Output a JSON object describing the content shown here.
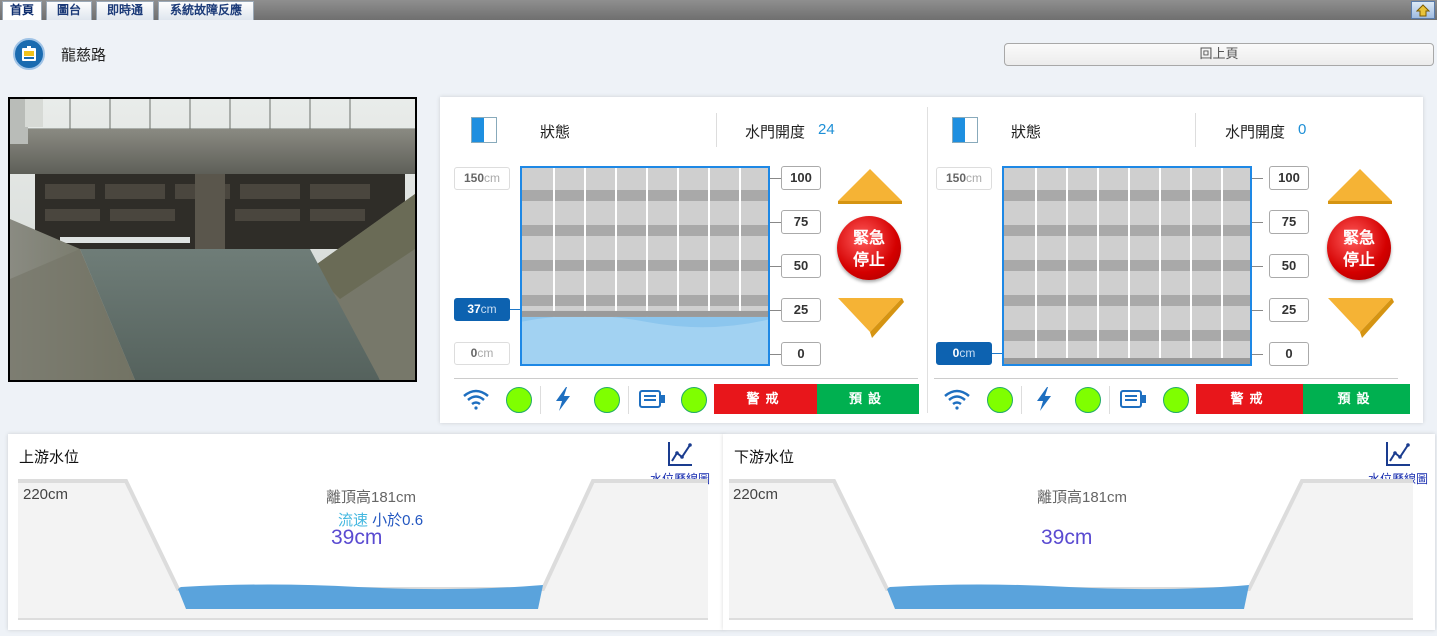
{
  "tabs": [
    {
      "label": "首頁",
      "active": true
    },
    {
      "label": "圖台",
      "active": false
    },
    {
      "label": "即時通",
      "active": false
    },
    {
      "label": "系統故障反應",
      "active": false
    }
  ],
  "header": {
    "location_name": "龍慈路",
    "back_label": "回上頁"
  },
  "gates": [
    {
      "status_label": "狀態",
      "opening_label": "水門開度",
      "opening_value": "24",
      "opening_fraction": 0.24,
      "top_label": {
        "num": "150",
        "unit": "cm"
      },
      "level_label": {
        "num": "37",
        "unit": "cm"
      },
      "bottom_label": {
        "num": "0",
        "unit": "cm"
      },
      "water_level_cm": 37,
      "max_cm": 150,
      "pct_labels": [
        "100",
        "75",
        "50",
        "25",
        "0"
      ],
      "stop_label_1": "緊急",
      "stop_label_2": "停止",
      "alert_label": "警戒",
      "preset_label": "預設"
    },
    {
      "status_label": "狀態",
      "opening_label": "水門開度",
      "opening_value": "0",
      "opening_fraction": 0,
      "top_label": {
        "num": "150",
        "unit": "cm"
      },
      "level_label": {
        "num": "0",
        "unit": "cm"
      },
      "bottom_label": {
        "num": "",
        "unit": ""
      },
      "water_level_cm": 0,
      "max_cm": 150,
      "pct_labels": [
        "100",
        "75",
        "50",
        "25",
        "0"
      ],
      "stop_label_1": "緊急",
      "stop_label_2": "停止",
      "alert_label": "警戒",
      "preset_label": "預設"
    }
  ],
  "water_levels": [
    {
      "title": "上游水位",
      "chart_link": "水位歷線圖",
      "top_label": "220cm",
      "distance": "離頂高181cm",
      "flow_a": "流速",
      "flow_b": " 小於0.6",
      "value": "39cm"
    },
    {
      "title": "下游水位",
      "chart_link": "水位歷線圖",
      "top_label": "220cm",
      "distance": "離頂高181cm",
      "flow_a": "",
      "flow_b": "",
      "value": "39cm"
    }
  ],
  "colors": {
    "accent": "#1e88e5",
    "level_badge": "#0d62b0",
    "water": "#5aa3dc",
    "ok_dot": "#7fff00",
    "alert_red": "#e8161b",
    "preset_green": "#00b050",
    "arrow_gold": "#f5b335"
  }
}
